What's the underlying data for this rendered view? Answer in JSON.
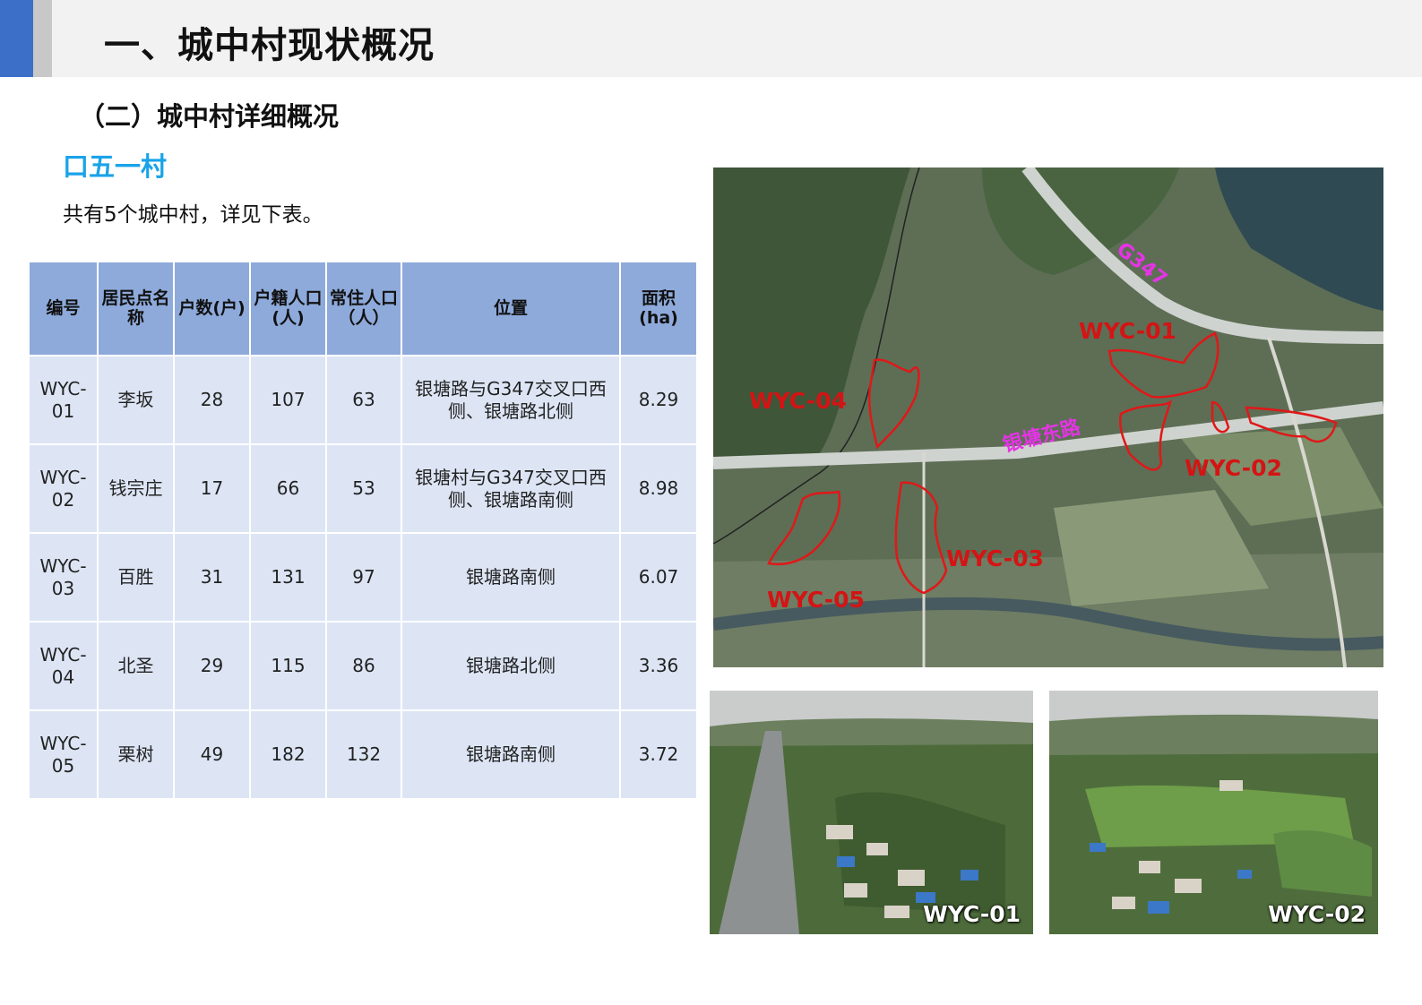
{
  "header": {
    "title": "一、城中村现状概况"
  },
  "section": {
    "title": "（二）城中村详细概况"
  },
  "subsection": {
    "title": "口五一村"
  },
  "intro": {
    "text": "共有5个城中村，详见下表。"
  },
  "table": {
    "headers": {
      "id": "编号",
      "name": "居民点名称",
      "households": "户数(户)",
      "registered": "户籍人口(人)",
      "resident": "常住人口（人）",
      "location": "位置",
      "area": "面积(ha)"
    },
    "rows": [
      {
        "id": "WYC-01",
        "name": "李坂",
        "households": "28",
        "registered": "107",
        "resident": "63",
        "location": "银塘路与G347交叉口西侧、银塘路北侧",
        "area": "8.29"
      },
      {
        "id": "WYC-02",
        "name": "钱宗庄",
        "households": "17",
        "registered": "66",
        "resident": "53",
        "location": "银塘村与G347交叉口西侧、银塘路南侧",
        "area": "8.98"
      },
      {
        "id": "WYC-03",
        "name": "百胜",
        "households": "31",
        "registered": "131",
        "resident": "97",
        "location": "银塘路南侧",
        "area": "6.07"
      },
      {
        "id": "WYC-04",
        "name": "北圣",
        "households": "29",
        "registered": "115",
        "resident": "86",
        "location": "银塘路北侧",
        "area": "3.36"
      },
      {
        "id": "WYC-05",
        "name": "栗树",
        "households": "49",
        "registered": "182",
        "resident": "132",
        "location": "银塘路南侧",
        "area": "3.72"
      }
    ]
  },
  "map": {
    "labels": {
      "wyc01": "WYC-01",
      "wyc02": "WYC-02",
      "wyc03": "WYC-03",
      "wyc04": "WYC-04",
      "wyc05": "WYC-05"
    },
    "roads": {
      "g347": "G347",
      "yintang": "银塘东路"
    },
    "colors": {
      "boundary": "#e01818",
      "road_label": "#e633e6"
    }
  },
  "photos": {
    "photo1_label": "WYC-01",
    "photo2_label": "WYC-02"
  }
}
